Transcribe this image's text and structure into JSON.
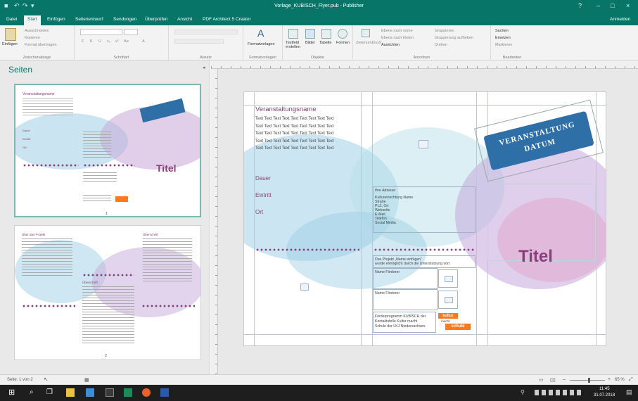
{
  "window": {
    "title": "Vorlage_KUBISCH_Flyer.pub - Publisher",
    "help": "?",
    "minimize": "–",
    "maximize": "□",
    "close": "×"
  },
  "tabs": [
    "Datei",
    "Start",
    "Einfügen",
    "Seitenentwurf",
    "Sendungen",
    "Überprüfen",
    "Ansicht",
    "PDF Architect 5 Creator"
  ],
  "active_tab": "Start",
  "signin": "Anmelden",
  "ribbon": {
    "clipboard": {
      "paste": "Einfügen",
      "cut": "Ausschneiden",
      "copy": "Kopieren",
      "format": "Format übertragen",
      "label": "Zwischenablage"
    },
    "font": {
      "label": "Schriftart",
      "bold": "F",
      "italic": "K",
      "underline": "U",
      "sub": "x₂",
      "sup": "x²",
      "aa": "Aa",
      "color": "A"
    },
    "paragraph": {
      "label": "Absatz"
    },
    "styles": {
      "btn": "Formatvorlagen",
      "label": "Formatvorlagen"
    },
    "objects": {
      "textfield": "Textfeld erstellen",
      "pictures": "Bilder",
      "table": "Tabelle",
      "shapes": "Formen",
      "label": "Objekte"
    },
    "arrange": {
      "wrap": "Zeilenumbruch",
      "forward": "Ebene nach vorne",
      "backward": "Ebene nach hinten",
      "align": "Ausrichten",
      "group": "Gruppieren",
      "ungroup": "Gruppierung aufheben",
      "rotate": "Drehen",
      "label": "Anordnen"
    },
    "edit": {
      "find": "Suchen",
      "replace": "Ersetzen",
      "select": "Markieren",
      "label": "Bearbeiten"
    }
  },
  "pages_pane": {
    "title": "Seiten",
    "page1_num": "1",
    "page2_num": "2",
    "thumb1": {
      "heading": "Veranstaltungsname",
      "title": "Titel",
      "dauer": "Dauer",
      "eintritt": "Eintritt",
      "ort": "Ort"
    },
    "thumb2": {
      "heading_left": "Über das Projekt",
      "heading_right": "Überschrift",
      "heading_mid": "Überschrift"
    }
  },
  "page": {
    "heading": "Veranstaltungsname",
    "body_line": "Text Text Text Text Text Text Text Text Text",
    "body_lines_count": 5,
    "dauer": "Dauer",
    "eintritt": "Eintritt",
    "ort": "Ort",
    "stamp_line1": "VERANSTALTUNG",
    "stamp_line2": "DATUM",
    "address_title": "Ihre Adresse",
    "address_lines": [
      "Kultureinrichtung Name",
      "Straße",
      "PLZ, Ort",
      "Webseite",
      "E-Mail",
      "Telefon",
      "Social Media"
    ],
    "project_line1": "Das Projekt „Name einfügen“",
    "project_line2": "wurde ermöglicht durch die Unterstützung von:",
    "sponsor1": "Name Förderer",
    "sponsor2": "Name Förderer",
    "program_lines": [
      "Förderprogramm KUBISCH der",
      "Kontaktstelle Kultur macht",
      "Schule der LKJ Niedersachsen."
    ],
    "logo_line1": "kultur",
    "logo_line2": "macht",
    "logo_line3": "schule",
    "title": "Titel"
  },
  "status": {
    "page": "Seite: 1 von 2",
    "zoom": "65 %"
  },
  "taskbar": {
    "time": "11:45",
    "date": "31.07.2018"
  },
  "colors": {
    "accent": "#077568",
    "title_purple": "#8a3f7a",
    "blue_band": "#2f6fa8"
  }
}
